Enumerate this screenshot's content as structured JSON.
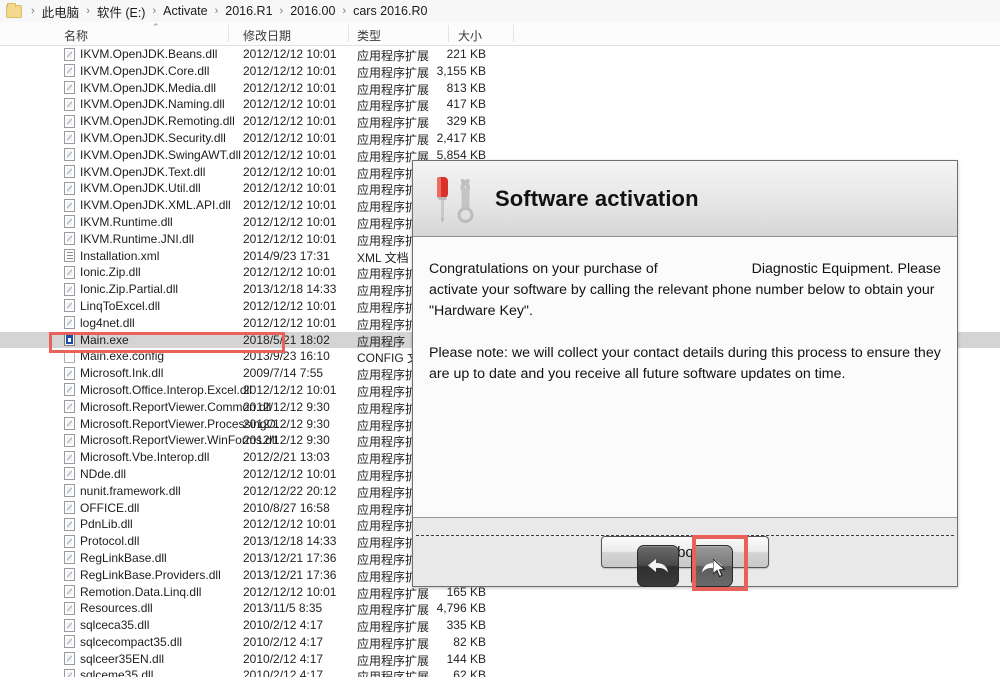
{
  "breadcrumb": {
    "folder_icon": "folder-icon",
    "separator": "›",
    "crumbs": [
      "此电脑",
      "软件 (E:)",
      "Activate",
      "2016.R1",
      "2016.00",
      "cars 2016.R0"
    ]
  },
  "columns": {
    "name": "名称",
    "date": "修改日期",
    "type": "类型",
    "size": "大小",
    "sort_caret": "⌃"
  },
  "types": {
    "dll": "应用程序扩展",
    "xml": "XML 文档",
    "exe": "应用程序",
    "config": "CONFIG 文件"
  },
  "files": [
    {
      "name": "IKVM.OpenJDK.Beans.dll",
      "date": "2012/12/12 10:01",
      "type": "应用程序扩展",
      "size": "221 KB",
      "icon": "dll",
      "selected": false
    },
    {
      "name": "IKVM.OpenJDK.Core.dll",
      "date": "2012/12/12 10:01",
      "type": "应用程序扩展",
      "size": "3,155 KB",
      "icon": "dll",
      "selected": false
    },
    {
      "name": "IKVM.OpenJDK.Media.dll",
      "date": "2012/12/12 10:01",
      "type": "应用程序扩展",
      "size": "813 KB",
      "icon": "dll",
      "selected": false
    },
    {
      "name": "IKVM.OpenJDK.Naming.dll",
      "date": "2012/12/12 10:01",
      "type": "应用程序扩展",
      "size": "417 KB",
      "icon": "dll",
      "selected": false
    },
    {
      "name": "IKVM.OpenJDK.Remoting.dll",
      "date": "2012/12/12 10:01",
      "type": "应用程序扩展",
      "size": "329 KB",
      "icon": "dll",
      "selected": false
    },
    {
      "name": "IKVM.OpenJDK.Security.dll",
      "date": "2012/12/12 10:01",
      "type": "应用程序扩展",
      "size": "2,417 KB",
      "icon": "dll",
      "selected": false
    },
    {
      "name": "IKVM.OpenJDK.SwingAWT.dll",
      "date": "2012/12/12 10:01",
      "type": "应用程序扩展",
      "size": "5,854 KB",
      "icon": "dll",
      "selected": false
    },
    {
      "name": "IKVM.OpenJDK.Text.dll",
      "date": "2012/12/12 10:01",
      "type": "应用程序扩",
      "size": "",
      "icon": "dll",
      "selected": false
    },
    {
      "name": "IKVM.OpenJDK.Util.dll",
      "date": "2012/12/12 10:01",
      "type": "应用程序扩",
      "size": "",
      "icon": "dll",
      "selected": false
    },
    {
      "name": "IKVM.OpenJDK.XML.API.dll",
      "date": "2012/12/12 10:01",
      "type": "应用程序扩",
      "size": "",
      "icon": "dll",
      "selected": false
    },
    {
      "name": "IKVM.Runtime.dll",
      "date": "2012/12/12 10:01",
      "type": "应用程序扩",
      "size": "",
      "icon": "dll",
      "selected": false
    },
    {
      "name": "IKVM.Runtime.JNI.dll",
      "date": "2012/12/12 10:01",
      "type": "应用程序扩",
      "size": "",
      "icon": "dll",
      "selected": false
    },
    {
      "name": "Installation.xml",
      "date": "2014/9/23 17:31",
      "type": "XML 文档",
      "size": "",
      "icon": "xml",
      "selected": false
    },
    {
      "name": "Ionic.Zip.dll",
      "date": "2012/12/12 10:01",
      "type": "应用程序扩",
      "size": "",
      "icon": "dll",
      "selected": false
    },
    {
      "name": "Ionic.Zip.Partial.dll",
      "date": "2013/12/18 14:33",
      "type": "应用程序扩",
      "size": "",
      "icon": "dll",
      "selected": false
    },
    {
      "name": "LinqToExcel.dll",
      "date": "2012/12/12 10:01",
      "type": "应用程序扩",
      "size": "",
      "icon": "dll",
      "selected": false
    },
    {
      "name": "log4net.dll",
      "date": "2012/12/12 10:01",
      "type": "应用程序扩",
      "size": "",
      "icon": "dll",
      "selected": false
    },
    {
      "name": "Main.exe",
      "date": "2018/5/21 18:02",
      "type": "应用程序",
      "size": "",
      "icon": "exe",
      "selected": true
    },
    {
      "name": "Main.exe.config",
      "date": "2013/9/23 16:10",
      "type": "CONFIG 文",
      "size": "",
      "icon": "cfg",
      "selected": false
    },
    {
      "name": "Microsoft.Ink.dll",
      "date": "2009/7/14 7:55",
      "type": "应用程序扩",
      "size": "",
      "icon": "dll",
      "selected": false
    },
    {
      "name": "Microsoft.Office.Interop.Excel.dll",
      "date": "2012/12/12 10:01",
      "type": "应用程序扩",
      "size": "",
      "icon": "dll",
      "selected": false
    },
    {
      "name": "Microsoft.ReportViewer.Common.dll",
      "date": "2012/12/12 9:30",
      "type": "应用程序扩",
      "size": "",
      "icon": "dll",
      "selected": false
    },
    {
      "name": "Microsoft.ReportViewer.ProcessingO...",
      "date": "2012/12/12 9:30",
      "type": "应用程序扩",
      "size": "",
      "icon": "dll",
      "selected": false
    },
    {
      "name": "Microsoft.ReportViewer.WinForms.dll",
      "date": "2012/12/12 9:30",
      "type": "应用程序扩",
      "size": "",
      "icon": "dll",
      "selected": false
    },
    {
      "name": "Microsoft.Vbe.Interop.dll",
      "date": "2012/2/21 13:03",
      "type": "应用程序扩",
      "size": "",
      "icon": "dll",
      "selected": false
    },
    {
      "name": "NDde.dll",
      "date": "2012/12/12 10:01",
      "type": "应用程序扩",
      "size": "",
      "icon": "dll",
      "selected": false
    },
    {
      "name": "nunit.framework.dll",
      "date": "2012/12/22 20:12",
      "type": "应用程序扩",
      "size": "",
      "icon": "dll",
      "selected": false
    },
    {
      "name": "OFFICE.dll",
      "date": "2010/8/27 16:58",
      "type": "应用程序扩",
      "size": "",
      "icon": "dll",
      "selected": false
    },
    {
      "name": "PdnLib.dll",
      "date": "2012/12/12 10:01",
      "type": "应用程序扩",
      "size": "",
      "icon": "dll",
      "selected": false
    },
    {
      "name": "Protocol.dll",
      "date": "2013/12/18 14:33",
      "type": "应用程序扩",
      "size": "",
      "icon": "dll",
      "selected": false
    },
    {
      "name": "RegLinkBase.dll",
      "date": "2013/12/21 17:36",
      "type": "应用程序扩",
      "size": "",
      "icon": "dll",
      "selected": false
    },
    {
      "name": "RegLinkBase.Providers.dll",
      "date": "2013/12/21 17:36",
      "type": "应用程序扩",
      "size": "",
      "icon": "dll",
      "selected": false
    },
    {
      "name": "Remotion.Data.Linq.dll",
      "date": "2012/12/12 10:01",
      "type": "应用程序扩展",
      "size": "165 KB",
      "icon": "dll",
      "selected": false
    },
    {
      "name": "Resources.dll",
      "date": "2013/11/5 8:35",
      "type": "应用程序扩展",
      "size": "4,796 KB",
      "icon": "dll",
      "selected": false
    },
    {
      "name": "sqlceca35.dll",
      "date": "2010/2/12 4:17",
      "type": "应用程序扩展",
      "size": "335 KB",
      "icon": "dll",
      "selected": false
    },
    {
      "name": "sqlcecompact35.dll",
      "date": "2010/2/12 4:17",
      "type": "应用程序扩展",
      "size": "82 KB",
      "icon": "dll",
      "selected": false
    },
    {
      "name": "sqlceer35EN.dll",
      "date": "2010/2/12 4:17",
      "type": "应用程序扩展",
      "size": "144 KB",
      "icon": "dll",
      "selected": false
    },
    {
      "name": "sqlceme35.dll",
      "date": "2010/2/12 4:17",
      "type": "应用程序扩展",
      "size": "62 KB",
      "icon": "dll",
      "selected": false
    }
  ],
  "dialog": {
    "title": "Software activation",
    "icon": "screwdriver-wrench-icon",
    "paragraph1_before": "Congratulations on your purchase of",
    "paragraph1_after": "Diagnostic Equipment. Please activate your software by calling the relevant phone number below to obtain your \"Hardware Key\".",
    "paragraph2": "Please note: we will collect your contact details during this process to ensure they are up to date and you receive all future software updates on time.",
    "back_icon": "back-arrow-icon",
    "forward_icon": "forward-arrow-icon",
    "abort_label": "Abort",
    "highlight_color": "#e8615a"
  }
}
